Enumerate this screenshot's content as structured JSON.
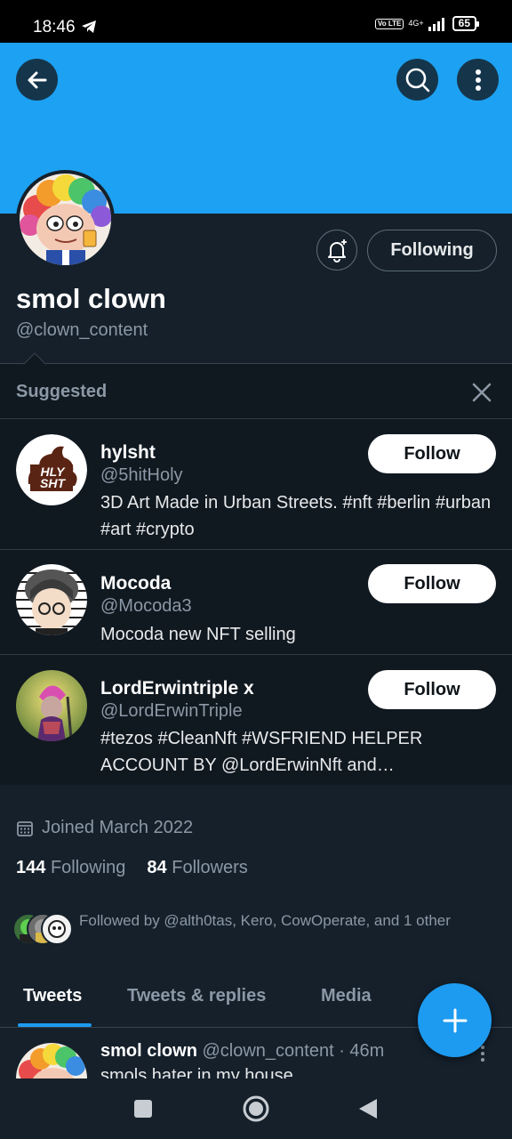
{
  "status_bar": {
    "time": "18:46",
    "volte": "Vo LTE",
    "network": "4G+",
    "battery": "65"
  },
  "profile": {
    "display_name": "smol clown",
    "handle": "@clown_content",
    "following_button": "Following",
    "joined": "Joined March 2022",
    "following_count": "144",
    "following_label": "Following",
    "followers_count": "84",
    "followers_label": "Followers",
    "followed_by": "Followed by @alth0tas, Kero, CowOperate, and 1 other"
  },
  "suggested": {
    "title": "Suggested",
    "items": [
      {
        "name": "hylsht",
        "handle": "@5hitHoly",
        "bio": "3D Art Made in Urban Streets. #nft #berlin #urban #art #crypto",
        "button": "Follow",
        "avatar_text": "HLY SHT"
      },
      {
        "name": "Mocoda",
        "handle": "@Mocoda3",
        "bio": "Mocoda new NFT selling",
        "button": "Follow"
      },
      {
        "name": "LordErwintriple x",
        "handle": "@LordErwinTriple",
        "bio": "#tezos #CleanNft #WSFRIEND HELPER ACCOUNT BY @LordErwinNft and @LordErwinTriple",
        "button": "Follow"
      }
    ]
  },
  "tabs": [
    "Tweets",
    "Tweets & replies",
    "Media"
  ],
  "active_tab": "Tweets",
  "tweet": {
    "name": "smol clown",
    "handle": "@clown_content",
    "time": "· 46m",
    "text": "smols hater in my house"
  },
  "colors": {
    "banner": "#1da1f2",
    "background": "#15202b",
    "accent": "#1d9bf0",
    "secondary_text": "#8b98a5"
  },
  "icons": {
    "back": "arrow-left-icon",
    "search": "search-icon",
    "more": "more-vertical-icon",
    "bell": "bell-plus-icon",
    "close": "close-icon",
    "calendar": "calendar-icon",
    "fab": "plus-icon"
  }
}
